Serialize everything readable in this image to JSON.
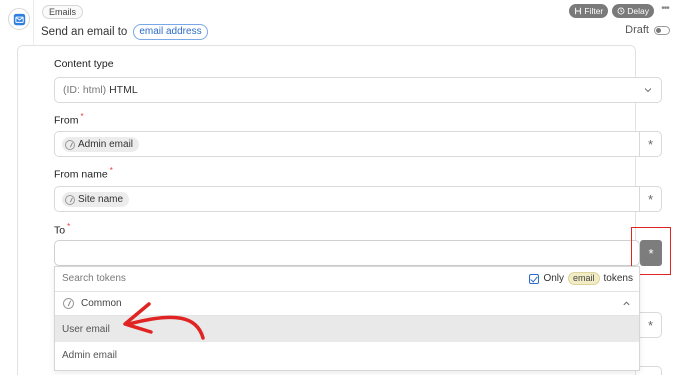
{
  "header": {
    "step_label": "Emails",
    "subtitle": "Send an email to",
    "subtitle_chip": "email address",
    "filter_label": "Filter",
    "delay_label": "Delay",
    "more_label": "•••",
    "draft_label": "Draft"
  },
  "form": {
    "content_type": {
      "label": "Content type",
      "id_hint": "(ID: html)",
      "value": "HTML"
    },
    "from": {
      "label": "From",
      "required": "*",
      "token": "Admin email",
      "asterisk": "*"
    },
    "from_name": {
      "label": "From name",
      "required": "*",
      "token": "Site name",
      "asterisk": "*"
    },
    "to": {
      "label": "To",
      "required": "*",
      "asterisk": "*"
    }
  },
  "dropdown": {
    "search_placeholder": "Search tokens",
    "only_label": "Only",
    "only_chip": "email",
    "only_suffix": "tokens",
    "group_label": "Common",
    "options": [
      "User email",
      "Admin email"
    ]
  },
  "ghost_asterisk": "*",
  "colors": {
    "accent": "#2d6bc9",
    "annotation": "#e02424"
  }
}
